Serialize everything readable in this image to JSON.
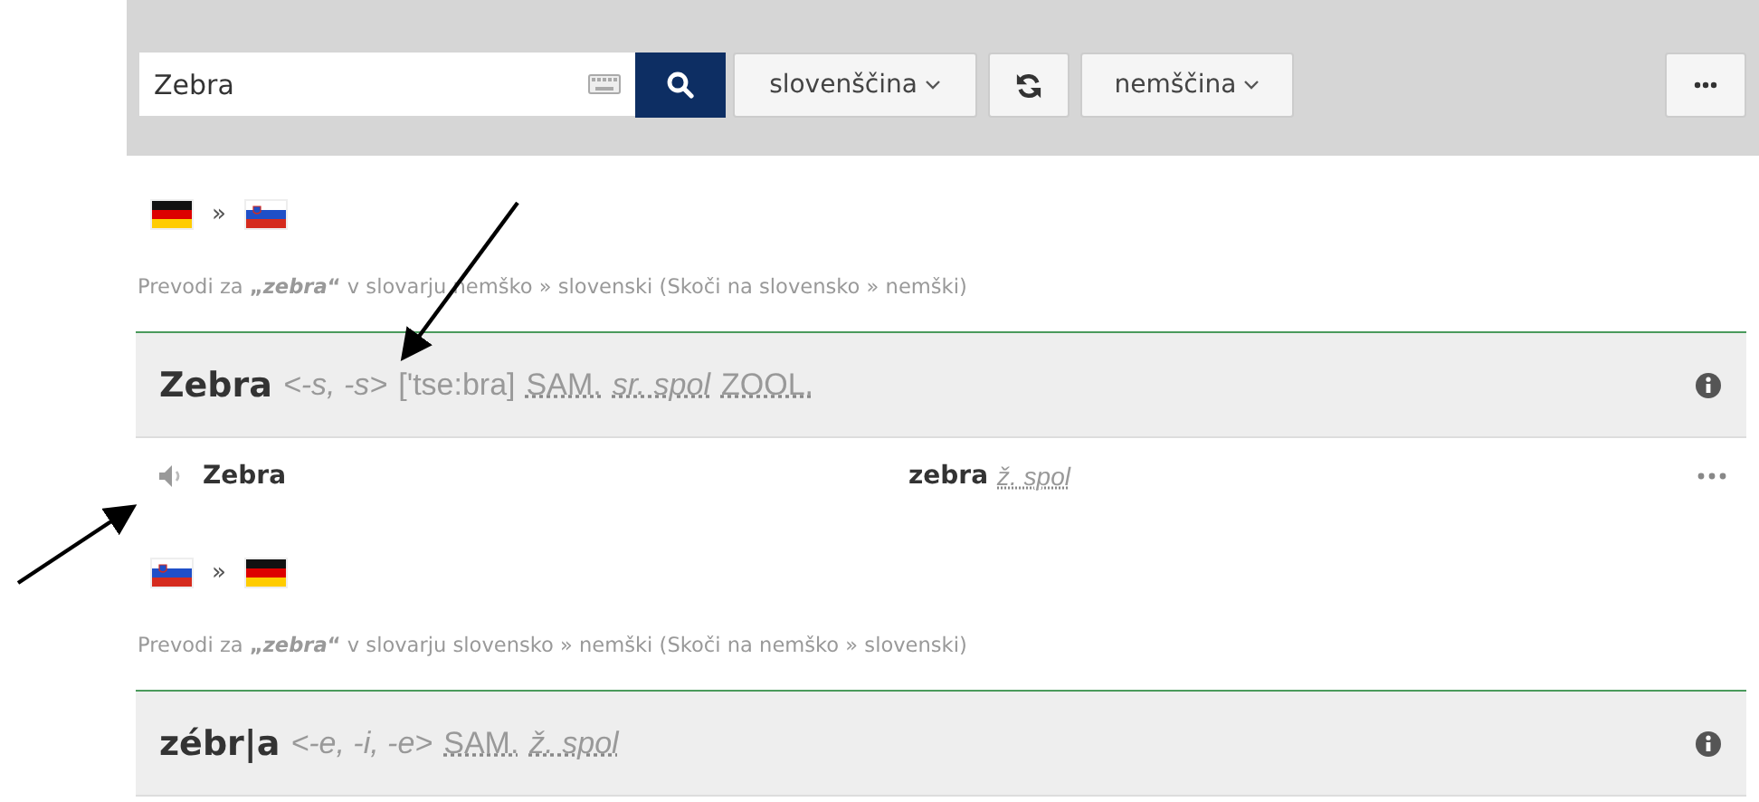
{
  "search": {
    "value": "Zebra"
  },
  "toolbar": {
    "source_language": "slovenščina",
    "target_language": "nemščina"
  },
  "sections": [
    {
      "flags": [
        {
          "kind": "de"
        },
        {
          "kind": "si"
        }
      ],
      "separator": "»",
      "info": "Prevodi za **„*zebra*“** v slovarju nemško » slovenski (Skoči na slovensko » nemški)",
      "entry": {
        "headword": "Zebra",
        "parts": [
          {
            "kind": "italic",
            "text": "<-s, -s>"
          },
          {
            "kind": "plain",
            "text": "['tse:bra]"
          },
          {
            "kind": "abbr",
            "text": "SAM."
          },
          {
            "kind": "abbr_italic",
            "text": "sr. spol"
          },
          {
            "kind": "abbr",
            "text": "ZOOL."
          }
        ],
        "translations": [
          {
            "source": "Zebra",
            "target": "zebra",
            "target_parts": [
              {
                "kind": "abbr_italic",
                "text": "ž. spol"
              }
            ]
          }
        ]
      }
    },
    {
      "flags": [
        {
          "kind": "si"
        },
        {
          "kind": "de"
        }
      ],
      "separator": "»",
      "info": "Prevodi za **„*zebra*“** v slovarju slovensko » nemški (Skoči na nemško » slovenski)",
      "entry": {
        "headword": "zébr|a",
        "parts": [
          {
            "kind": "italic",
            "text": "<-e, -i, -e>"
          },
          {
            "kind": "abbr",
            "text": "SAM."
          },
          {
            "kind": "abbr_italic",
            "text": "ž. spol"
          }
        ]
      }
    }
  ]
}
